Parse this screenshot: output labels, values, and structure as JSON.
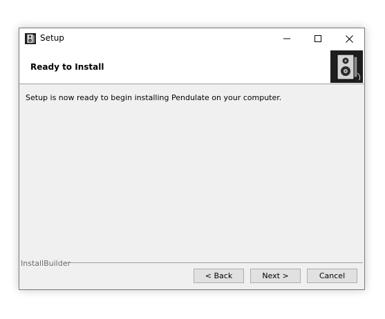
{
  "window": {
    "title": "Setup",
    "icon": "speaker-box-icon"
  },
  "header": {
    "title": "Ready to Install",
    "image": "speaker-box-icon"
  },
  "content": {
    "message": "Setup is now ready to begin installing Pendulate on your computer."
  },
  "footer": {
    "brand": "InstallBuilder",
    "buttons": {
      "back": "< Back",
      "next": "Next >",
      "cancel": "Cancel"
    }
  },
  "colors": {
    "window_bg": "#f0f0f0",
    "header_bg": "#ffffff",
    "button_bg": "#e1e1e1",
    "button_border": "#adadad",
    "brand_text": "#6d6d6d"
  }
}
